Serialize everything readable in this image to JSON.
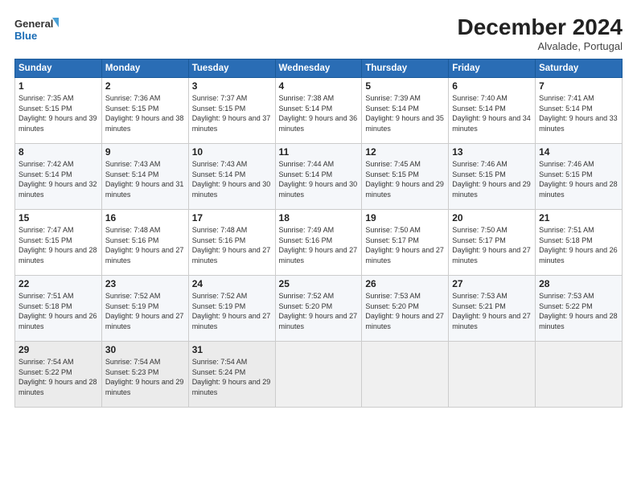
{
  "logo": {
    "line1": "General",
    "line2": "Blue"
  },
  "title": "December 2024",
  "location": "Alvalade, Portugal",
  "days_header": [
    "Sunday",
    "Monday",
    "Tuesday",
    "Wednesday",
    "Thursday",
    "Friday",
    "Saturday"
  ],
  "weeks": [
    [
      {
        "day": "1",
        "sunrise": "7:35 AM",
        "sunset": "5:15 PM",
        "daylight": "9 hours and 39 minutes."
      },
      {
        "day": "2",
        "sunrise": "7:36 AM",
        "sunset": "5:15 PM",
        "daylight": "9 hours and 38 minutes."
      },
      {
        "day": "3",
        "sunrise": "7:37 AM",
        "sunset": "5:15 PM",
        "daylight": "9 hours and 37 minutes."
      },
      {
        "day": "4",
        "sunrise": "7:38 AM",
        "sunset": "5:14 PM",
        "daylight": "9 hours and 36 minutes."
      },
      {
        "day": "5",
        "sunrise": "7:39 AM",
        "sunset": "5:14 PM",
        "daylight": "9 hours and 35 minutes."
      },
      {
        "day": "6",
        "sunrise": "7:40 AM",
        "sunset": "5:14 PM",
        "daylight": "9 hours and 34 minutes."
      },
      {
        "day": "7",
        "sunrise": "7:41 AM",
        "sunset": "5:14 PM",
        "daylight": "9 hours and 33 minutes."
      }
    ],
    [
      {
        "day": "8",
        "sunrise": "7:42 AM",
        "sunset": "5:14 PM",
        "daylight": "9 hours and 32 minutes."
      },
      {
        "day": "9",
        "sunrise": "7:43 AM",
        "sunset": "5:14 PM",
        "daylight": "9 hours and 31 minutes."
      },
      {
        "day": "10",
        "sunrise": "7:43 AM",
        "sunset": "5:14 PM",
        "daylight": "9 hours and 30 minutes."
      },
      {
        "day": "11",
        "sunrise": "7:44 AM",
        "sunset": "5:14 PM",
        "daylight": "9 hours and 30 minutes."
      },
      {
        "day": "12",
        "sunrise": "7:45 AM",
        "sunset": "5:15 PM",
        "daylight": "9 hours and 29 minutes."
      },
      {
        "day": "13",
        "sunrise": "7:46 AM",
        "sunset": "5:15 PM",
        "daylight": "9 hours and 29 minutes."
      },
      {
        "day": "14",
        "sunrise": "7:46 AM",
        "sunset": "5:15 PM",
        "daylight": "9 hours and 28 minutes."
      }
    ],
    [
      {
        "day": "15",
        "sunrise": "7:47 AM",
        "sunset": "5:15 PM",
        "daylight": "9 hours and 28 minutes."
      },
      {
        "day": "16",
        "sunrise": "7:48 AM",
        "sunset": "5:16 PM",
        "daylight": "9 hours and 27 minutes."
      },
      {
        "day": "17",
        "sunrise": "7:48 AM",
        "sunset": "5:16 PM",
        "daylight": "9 hours and 27 minutes."
      },
      {
        "day": "18",
        "sunrise": "7:49 AM",
        "sunset": "5:16 PM",
        "daylight": "9 hours and 27 minutes."
      },
      {
        "day": "19",
        "sunrise": "7:50 AM",
        "sunset": "5:17 PM",
        "daylight": "9 hours and 27 minutes."
      },
      {
        "day": "20",
        "sunrise": "7:50 AM",
        "sunset": "5:17 PM",
        "daylight": "9 hours and 27 minutes."
      },
      {
        "day": "21",
        "sunrise": "7:51 AM",
        "sunset": "5:18 PM",
        "daylight": "9 hours and 26 minutes."
      }
    ],
    [
      {
        "day": "22",
        "sunrise": "7:51 AM",
        "sunset": "5:18 PM",
        "daylight": "9 hours and 26 minutes."
      },
      {
        "day": "23",
        "sunrise": "7:52 AM",
        "sunset": "5:19 PM",
        "daylight": "9 hours and 27 minutes."
      },
      {
        "day": "24",
        "sunrise": "7:52 AM",
        "sunset": "5:19 PM",
        "daylight": "9 hours and 27 minutes."
      },
      {
        "day": "25",
        "sunrise": "7:52 AM",
        "sunset": "5:20 PM",
        "daylight": "9 hours and 27 minutes."
      },
      {
        "day": "26",
        "sunrise": "7:53 AM",
        "sunset": "5:20 PM",
        "daylight": "9 hours and 27 minutes."
      },
      {
        "day": "27",
        "sunrise": "7:53 AM",
        "sunset": "5:21 PM",
        "daylight": "9 hours and 27 minutes."
      },
      {
        "day": "28",
        "sunrise": "7:53 AM",
        "sunset": "5:22 PM",
        "daylight": "9 hours and 28 minutes."
      }
    ],
    [
      {
        "day": "29",
        "sunrise": "7:54 AM",
        "sunset": "5:22 PM",
        "daylight": "9 hours and 28 minutes."
      },
      {
        "day": "30",
        "sunrise": "7:54 AM",
        "sunset": "5:23 PM",
        "daylight": "9 hours and 29 minutes."
      },
      {
        "day": "31",
        "sunrise": "7:54 AM",
        "sunset": "5:24 PM",
        "daylight": "9 hours and 29 minutes."
      },
      null,
      null,
      null,
      null
    ]
  ],
  "labels": {
    "sunrise": "Sunrise:",
    "sunset": "Sunset:",
    "daylight": "Daylight hours"
  }
}
